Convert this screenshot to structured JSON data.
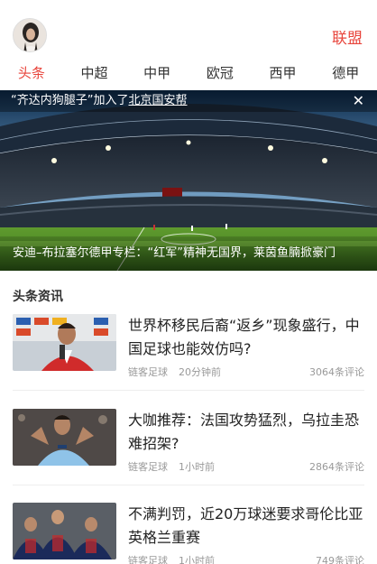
{
  "header": {
    "league_link": "联盟"
  },
  "tabs": [
    "头条",
    "中超",
    "中甲",
    "欧冠",
    "西甲",
    "德甲"
  ],
  "banner": {
    "notice_prefix": "“齐达内狗腿子”加入了",
    "notice_club": "北京国安帮",
    "close_symbol": "✕",
    "caption": "安迪–布拉塞尔德甲专栏：“红军”精神无国界，莱茵鱼腩掀豪门"
  },
  "section": {
    "title": "头条资讯"
  },
  "news": [
    {
      "title": "世界杯移民后裔“返乡”现象盛行，中国足球也能效仿吗?",
      "source": "链客足球",
      "time": "20分钟前",
      "comments": "3064条评论"
    },
    {
      "title": "大咖推荐：法国攻势猛烈，乌拉圭恐难招架?",
      "source": "链客足球",
      "time": "1小时前",
      "comments": "2864条评论"
    },
    {
      "title": "不满判罚，近20万球迷要求哥伦比亚英格兰重赛",
      "source": "链客足球",
      "time": "1小时前",
      "comments": "749条评论"
    }
  ],
  "colors": {
    "accent": "#e8453c"
  }
}
